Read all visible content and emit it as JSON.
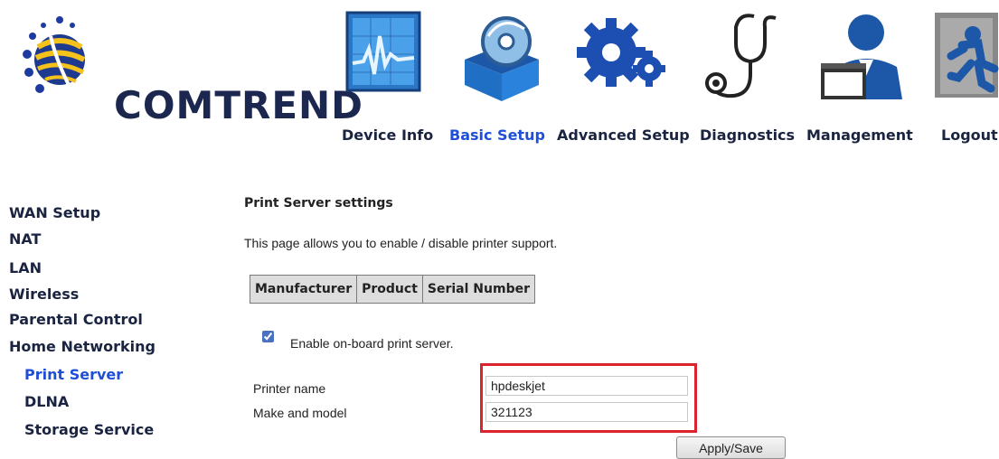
{
  "header": {
    "logo_text": "COMTREND",
    "nav": [
      {
        "label": "Device Info",
        "icon": "device-info-icon"
      },
      {
        "label": "Basic Setup",
        "icon": "basic-setup-icon",
        "active": true
      },
      {
        "label": "Advanced Setup",
        "icon": "advanced-setup-icon"
      },
      {
        "label": "Diagnostics",
        "icon": "diagnostics-icon"
      },
      {
        "label": "Management",
        "icon": "management-icon"
      },
      {
        "label": "Logout",
        "icon": "logout-icon"
      }
    ]
  },
  "sidebar": {
    "items": [
      {
        "label": "WAN Setup"
      },
      {
        "label": "NAT"
      },
      {
        "label": "LAN"
      },
      {
        "label": "Wireless"
      },
      {
        "label": "Parental Control"
      },
      {
        "label": "Home Networking"
      },
      {
        "label": "Print Server",
        "active": true
      },
      {
        "label": "DLNA"
      },
      {
        "label": "Storage Service"
      }
    ]
  },
  "content": {
    "title": "Print Server settings",
    "description": "This page allows you to enable / disable printer support.",
    "table_headers": [
      "Manufacturer",
      "Product",
      "Serial Number"
    ],
    "enable_label": "Enable on-board print server.",
    "enable_checked": true,
    "printer_name_label": "Printer name",
    "printer_name_value": "hpdeskjet",
    "make_model_label": "Make and model",
    "make_model_value": "321123",
    "apply_label": "Apply/Save"
  },
  "colors": {
    "nav_active": "#1f4fd6",
    "nav_text": "#1a2440",
    "highlight": "#d9232e",
    "table_header_bg": "#dddddd"
  }
}
